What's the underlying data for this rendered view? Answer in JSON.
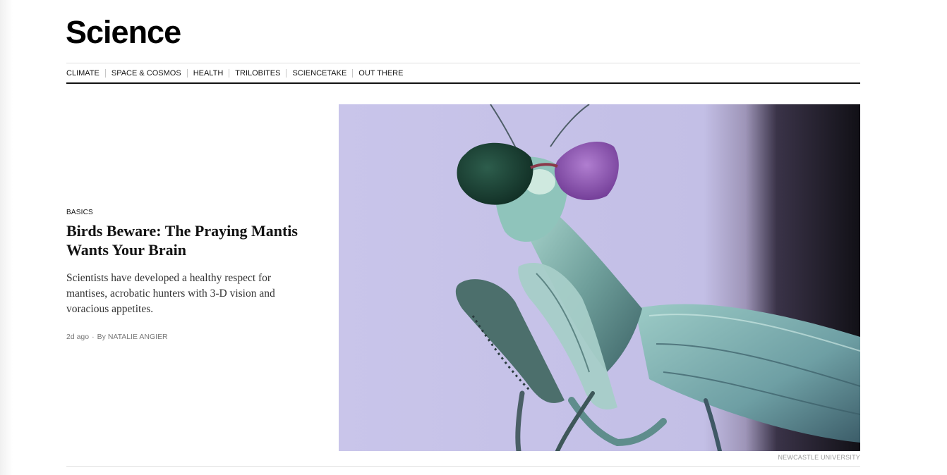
{
  "section": {
    "title": "Science"
  },
  "subnav": {
    "items": [
      {
        "label": "CLIMATE"
      },
      {
        "label": "SPACE & COSMOS"
      },
      {
        "label": "HEALTH"
      },
      {
        "label": "TRILOBITES"
      },
      {
        "label": "SCIENCETAKE"
      },
      {
        "label": "OUT THERE"
      }
    ]
  },
  "story": {
    "kicker": "BASICS",
    "headline": "Birds Beware: The Praying Mantis Wants Your Brain",
    "summary": "Scientists have developed a healthy respect for mantises, acrobatic hunters with 3-D vision and voracious appetites.",
    "timestamp": "2d ago",
    "byline_prefix": "By",
    "author": "NATALIE ANGIER",
    "meta_separator": "·",
    "image": {
      "subject": "praying mantis wearing green and purple 3-D glasses",
      "credit": "NEWCASTLE UNIVERSITY",
      "colors": {
        "background": "#c7c3e7",
        "dark_edge": "#1a1820",
        "mantis_body": "#7fb3ad",
        "mantis_dark": "#3f6b6a",
        "lens_left": "#1f4a3d",
        "lens_right": "#8a4fa6"
      }
    }
  }
}
